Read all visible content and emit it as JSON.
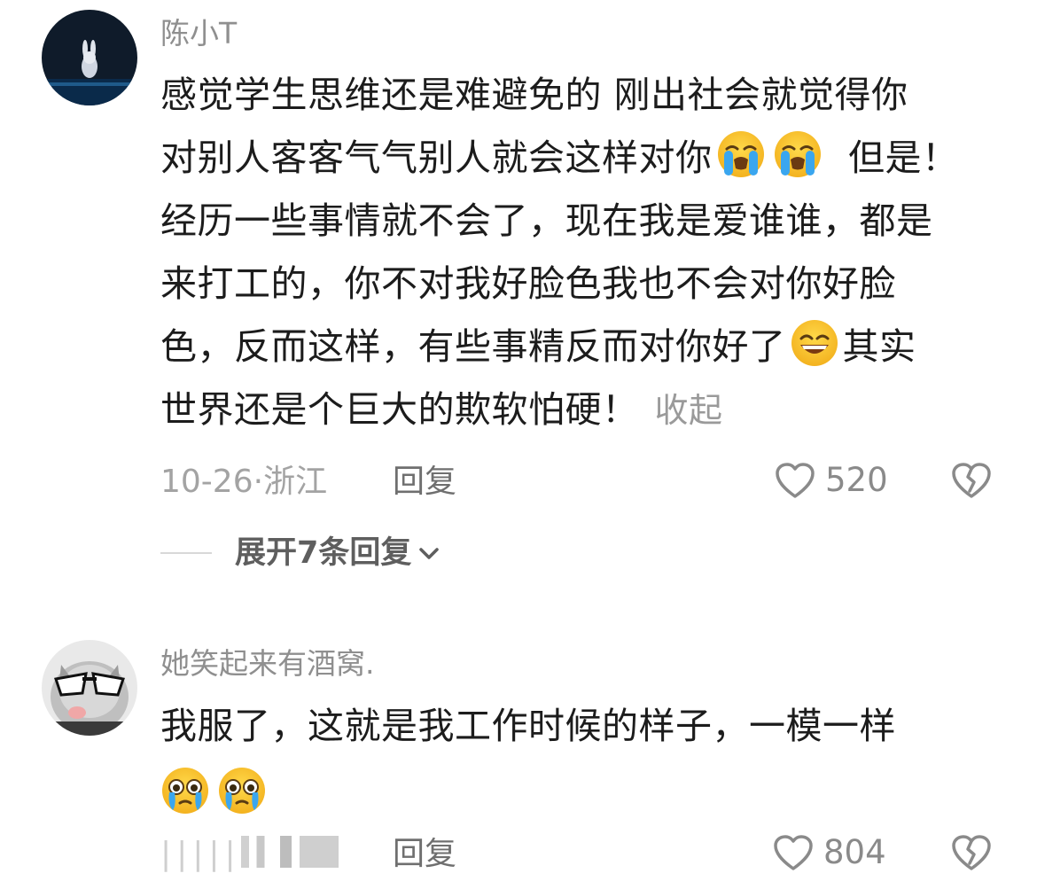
{
  "comments": [
    {
      "username": "陈小T",
      "lines": [
        "感觉学生思维还是难避免的  刚出社会就觉得你",
        "对别人客客气气别人就会这样对你",
        "经历一些事情就不会了，现在我是爱谁谁，都是",
        "来打工的，你不对我好脸色我也不会对你好脸",
        "色，反而这样，有些事精反而对你好了",
        "世界还是个巨大的欺软怕硬！"
      ],
      "line2_tail": "但是！",
      "line5_tail": "其实",
      "collapse_label": "收起",
      "date": "10-26",
      "location": "浙江",
      "reply_label": "回复",
      "likes": "520",
      "expand_label": "展开7条回复",
      "emojis": [
        "loudly-crying-face",
        "loudly-crying-face",
        "grinning-sweat-face"
      ]
    },
    {
      "username": "她笑起来有酒窝.",
      "lines": [
        "我服了，这就是我工作时候的样子，一模一样"
      ],
      "reply_label": "回复",
      "likes": "804",
      "meta_partial": "|||||",
      "emojis": [
        "crying-face",
        "crying-face"
      ]
    }
  ],
  "colors": {
    "text": "#1c1c1c",
    "muted": "#8f8f8f",
    "emoji_yellow": "#f7c531",
    "tear_blue": "#3aa6ef"
  }
}
